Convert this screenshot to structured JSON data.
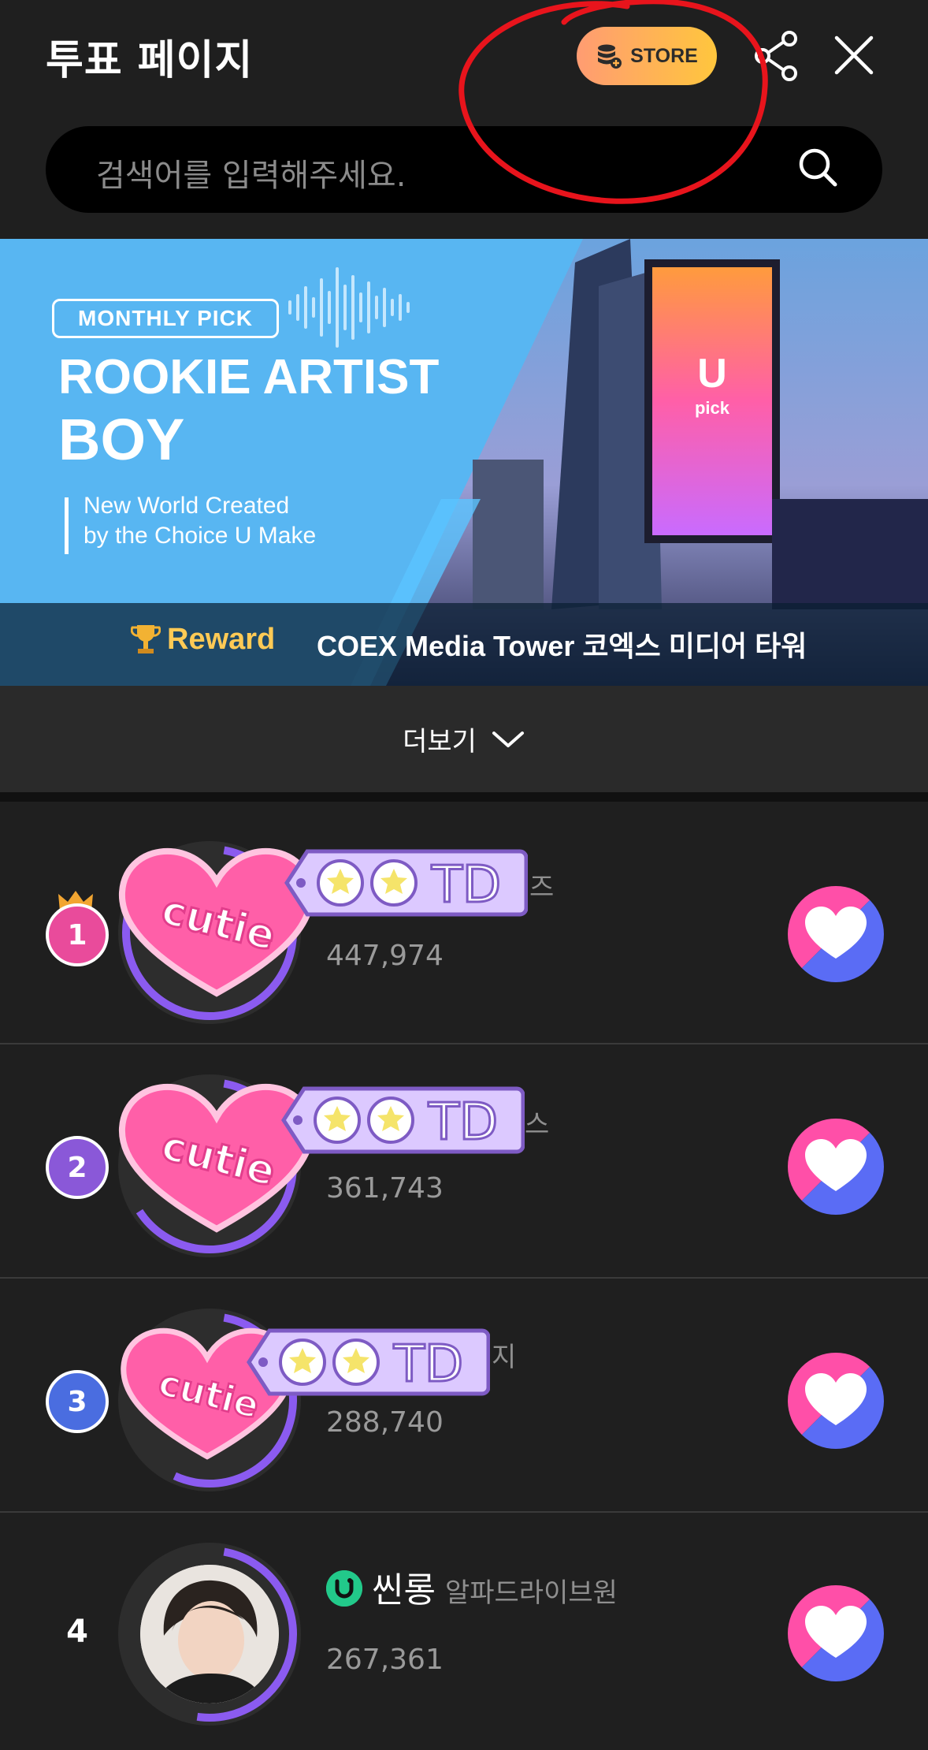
{
  "header": {
    "title": "투표 페이지",
    "store_label": "STORE",
    "search_placeholder": "검색어를 입력해주세요."
  },
  "banner": {
    "pill": "MONTHLY PICK",
    "title_line1": "ROOKIE ARTIST",
    "title_line2": "BOY",
    "subtitle_line1": "New World Created",
    "subtitle_line2": "by the Choice U Make",
    "reward_label": "Reward",
    "reward_text": "COEX Media Tower 코엑스 미디어 타워"
  },
  "more_label": "더보기",
  "ranks": [
    {
      "rank": "1",
      "group_fragment": "즈",
      "votes": "447,974",
      "sticker_heart": "cutie",
      "sticker_tag": "OOTD"
    },
    {
      "rank": "2",
      "group_fragment": "스",
      "votes": "361,743",
      "sticker_heart": "cutie",
      "sticker_tag": "OOTD"
    },
    {
      "rank": "3",
      "group_fragment": "지",
      "votes": "288,740",
      "sticker_heart": "cutie",
      "sticker_tag": "OOTD"
    },
    {
      "rank": "4",
      "name": "씬롱",
      "group": "알파드라이브원",
      "votes": "267,361"
    }
  ],
  "colors": {
    "background": "#1f1f1f",
    "store_gradient_start": "#ff9c72",
    "store_gradient_end": "#ffc63d",
    "rank1_badge": "#e94b9b",
    "rank2_badge": "#8a58d8",
    "rank3_badge": "#4a6de0",
    "vote_pink": "#ff4fa8",
    "vote_blue": "#5a6cf5",
    "annotation_red": "#e8141c"
  },
  "icons": {
    "store": "coin-stack-plus-icon",
    "share": "share-icon",
    "close": "close-icon",
    "search": "search-icon",
    "trophy": "trophy-icon",
    "crown": "crown-icon",
    "vote": "heart-icon",
    "verified": "u-pick-badge-icon"
  }
}
